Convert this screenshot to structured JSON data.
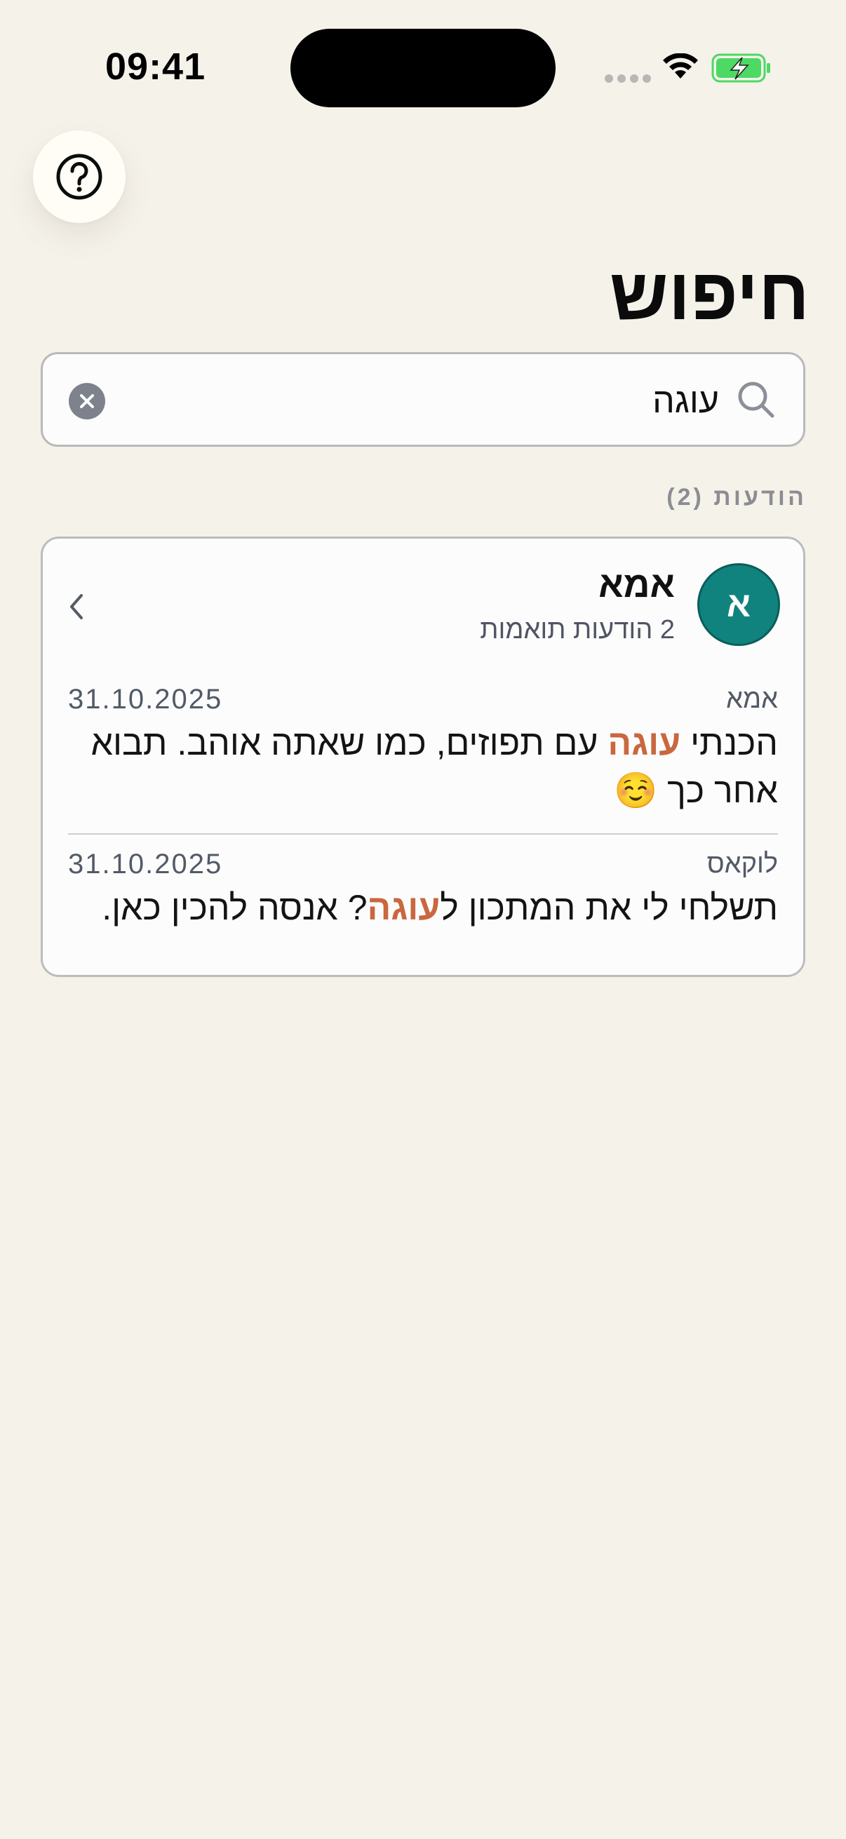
{
  "status_bar": {
    "time": "09:41",
    "battery_color": "#4cd964"
  },
  "help": {
    "icon": "question-circle-icon"
  },
  "header": {
    "title": "חיפוש"
  },
  "search": {
    "value": "עוגה",
    "icon": "search-icon",
    "clear_icon": "close-icon"
  },
  "results": {
    "section_label": "הודעות (2)",
    "conversation": {
      "avatar_initial": "א",
      "avatar_color": "#10837e",
      "name": "אמא",
      "match_count": "2 הודעות תואמות",
      "messages": [
        {
          "sender": "אמא",
          "date": "31.10.2025",
          "text_before": "הכנתי ",
          "highlight": "עוגה",
          "text_after": " עם תפוזים, כמו שאתה אוהב. תבוא אחר כך ☺️"
        },
        {
          "sender": "לוקאס",
          "date": "31.10.2025",
          "text_before": "תשלחי לי את המתכון ל",
          "highlight": "עוגה",
          "text_after": "? אנסה להכין כאן."
        }
      ]
    }
  },
  "colors": {
    "background": "#f5f2ea",
    "highlight": "#c9673e"
  }
}
